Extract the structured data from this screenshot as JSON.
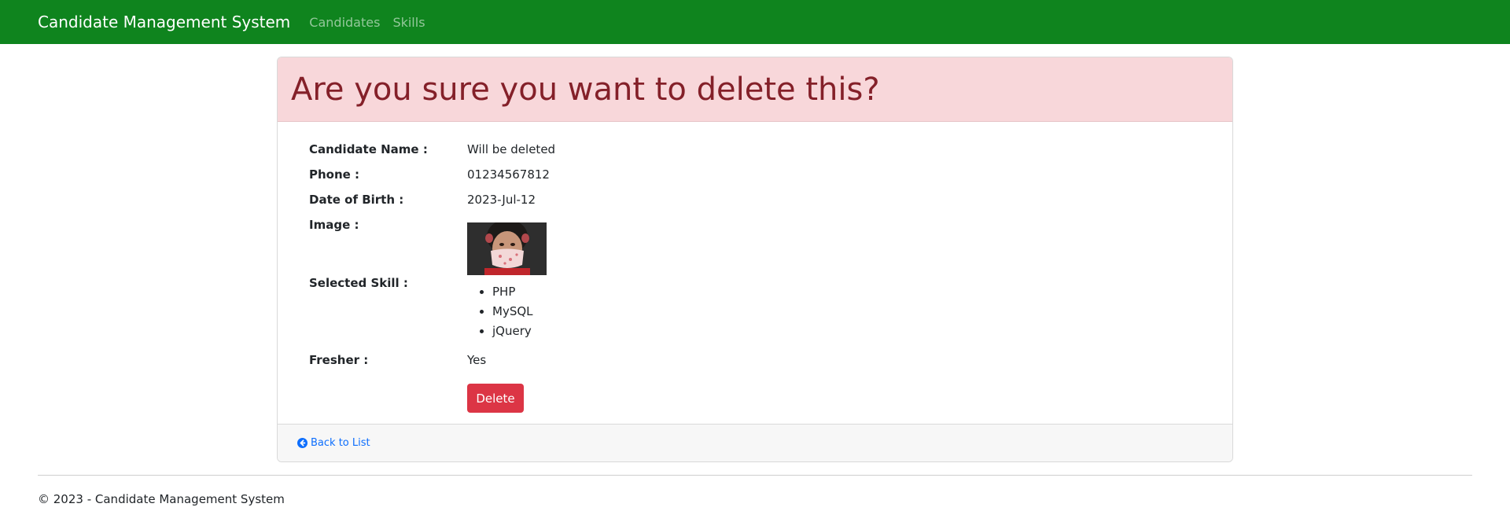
{
  "navbar": {
    "brand": "Candidate Management System",
    "links": [
      "Candidates",
      "Skills"
    ],
    "bg_color": "#0f841e"
  },
  "card": {
    "header": "Are you sure you want to delete this?",
    "fields": {
      "name_label": "Candidate Name :",
      "name_value": "Will be deleted",
      "phone_label": "Phone :",
      "phone_value": "01234567812",
      "dob_label": "Date of Birth :",
      "dob_value": "2023-Jul-12",
      "image_label": "Image :",
      "skills_label": "Selected Skill :",
      "skills": [
        "PHP",
        "MySQL",
        "jQuery"
      ],
      "fresher_label": "Fresher :",
      "fresher_value": "Yes"
    },
    "delete_label": "Delete",
    "back_label": "Back to List",
    "danger_color": "#dc3545",
    "header_bg": "#f8d7da"
  },
  "footer": {
    "copyright": "© 2023 - Candidate Management System"
  }
}
